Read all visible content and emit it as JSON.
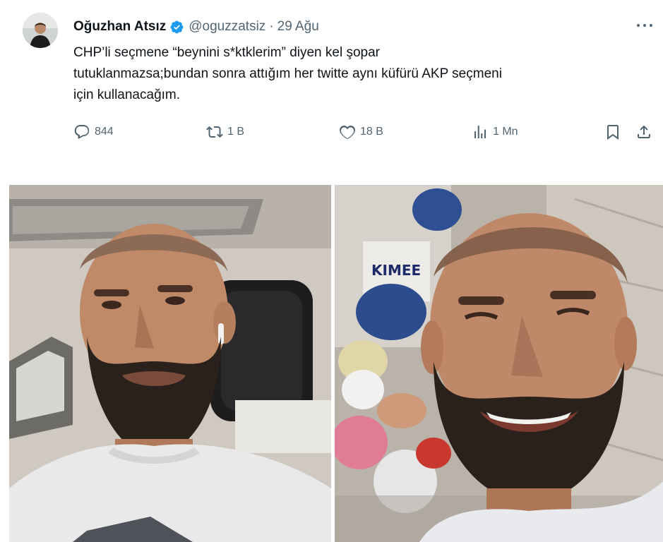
{
  "tweet": {
    "author": {
      "display_name": "Oğuzhan Atsız",
      "handle": "@oguzzatsiz",
      "verified": true
    },
    "separator": "·",
    "date": "29 Ağu",
    "text_lines": [
      "CHP’li seçmene “beynini s*ktklerim” diyen kel şopar",
      "tutuklanmazsa;bundan sonra attığım her twitte aynı küfürü AKP seçmeni",
      "için kullanacağım."
    ],
    "stats": {
      "replies": "844",
      "retweets": "1 B",
      "likes": "18 B",
      "views": "1 Mn"
    }
  },
  "icons": {
    "verified": "verified-badge-icon",
    "more": "more-options-icon",
    "reply": "reply-icon",
    "retweet": "retweet-icon",
    "like": "heart-icon",
    "views": "views-chart-icon",
    "bookmark": "bookmark-icon",
    "share": "share-icon"
  },
  "colors": {
    "text": "#0f1419",
    "secondary": "#536471",
    "verified": "#1d9bf0",
    "background": "#ffffff"
  }
}
